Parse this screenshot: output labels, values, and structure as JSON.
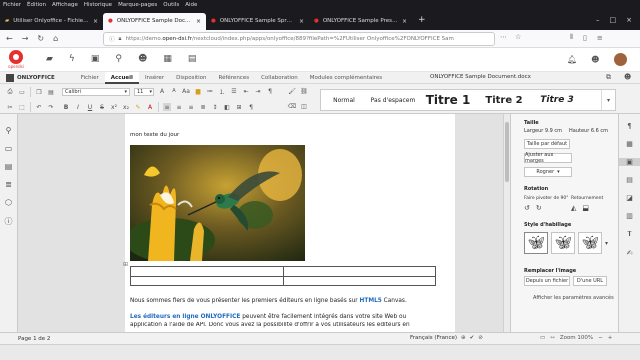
{
  "browser": {
    "menu": [
      "Fichier",
      "Édition",
      "Affichage",
      "Historique",
      "Marque-pages",
      "Outils",
      "Aide"
    ],
    "tabs": [
      {
        "label": "Utiliser Onlyoffice - Fichiers - N"
      },
      {
        "label": "ONLYOFFICE Sample Document"
      },
      {
        "label": "ONLYOFFICE Sample Spreadsh"
      },
      {
        "label": "ONLYOFFICE Sample Presentat"
      }
    ],
    "new_tab": "+",
    "url_prefix": "https://demo.",
    "url_domain": "open-dsi.fr",
    "url_rest": "/nextcloud/index.php/apps/onlyoffice/889?filePath=%2FUtiliser Onlyoffice%2FONLYOFFICE Sam"
  },
  "nextcloud": {
    "logo_label": "opendsi"
  },
  "editor": {
    "brand": "ONLYOFFICE",
    "tabs": [
      "Fichier",
      "Accueil",
      "Insérer",
      "Disposition",
      "Références",
      "Collaboration",
      "Modules complémentaires"
    ],
    "active_tab": "Accueil",
    "doc_title": "ONLYOFFICE Sample Document.docx",
    "font_name": "Calibri",
    "font_size": "11",
    "styles": [
      "Normal",
      "Pas d'espacem",
      "Titre 1",
      "Titre 2",
      "Titre 3"
    ]
  },
  "document": {
    "caption": "mon texte du jour",
    "para1_a": "Nous sommes fiers de vous présenter les premiers éditeurs en ligne basés sur ",
    "para1_b": "HTML5",
    "para1_c": " Canvas.",
    "para2_a": "Les éditeurs en ligne ONLYOFFICE",
    "para2_b": " peuvent être facilement intégrés dans votre site Web ou",
    "para2_line2": "application à l'aide de API. Donc vous avez la possibilité d'offrir à vos utilisateurs les éditeurs en"
  },
  "panel": {
    "size_title": "Taille",
    "width": "Largeur 9.9 cm",
    "height": "Hauteur 6.6 cm",
    "default_size": "Taille par défaut",
    "fit_margins": "Ajuster aux marges",
    "crop": "Rogner",
    "rotation_title": "Rotation",
    "rotate_label": "Faire pivoter de 90°",
    "flip_label": "Retournement",
    "wrap_title": "Style d'habillage",
    "replace_title": "Remplacer l'image",
    "from_file": "Depuis un fichier",
    "from_url": "D'une URL",
    "advanced": "Afficher les paramètres avancés"
  },
  "status": {
    "page": "Page 1 de 2",
    "language": "Français (France)",
    "zoom": "Zoom 100%"
  },
  "colors": {
    "accent_red": "#e62e2e",
    "link_blue": "#1f6bbf",
    "dark_chrome": "#1b1b1f"
  }
}
